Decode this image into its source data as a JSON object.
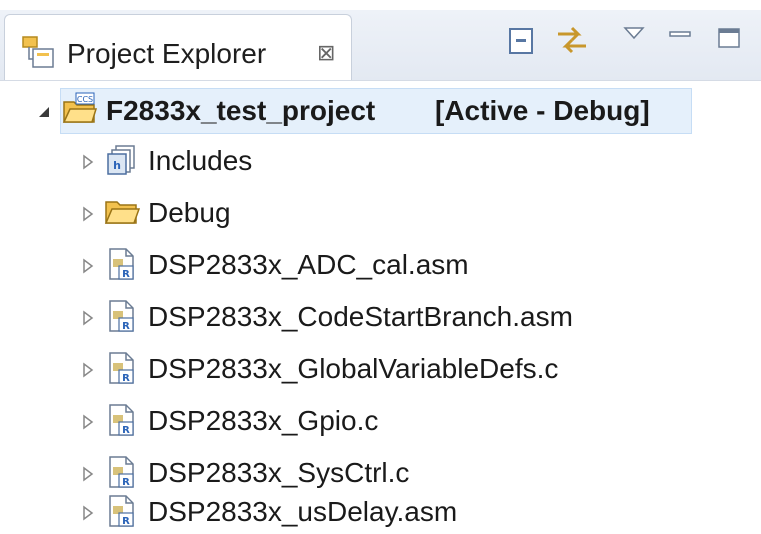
{
  "view": {
    "title": "Project Explorer",
    "close_glyph": "⊠",
    "toolbar": {
      "collapse_all_icon": "collapse-all-icon",
      "link_editor_icon": "link-with-editor-icon",
      "view_menu_icon": "view-menu-icon",
      "minimize_icon": "minimize-icon",
      "maximize_icon": "maximize-icon"
    }
  },
  "tree": {
    "project": {
      "name": "F2833x_test_project",
      "status": "[Active - Debug]",
      "badge": "CCS",
      "expanded": true
    },
    "items": [
      {
        "label": "Includes",
        "icon": "includes-icon"
      },
      {
        "label": "Debug",
        "icon": "folder-icon"
      },
      {
        "label": "DSP2833x_ADC_cal.asm",
        "icon": "source-file-icon"
      },
      {
        "label": "DSP2833x_CodeStartBranch.asm",
        "icon": "source-file-icon"
      },
      {
        "label": "DSP2833x_GlobalVariableDefs.c",
        "icon": "source-file-icon"
      },
      {
        "label": "DSP2833x_Gpio.c",
        "icon": "source-file-icon"
      },
      {
        "label": "DSP2833x_SysCtrl.c",
        "icon": "source-file-icon"
      },
      {
        "label": "DSP2833x_usDelay.asm",
        "icon": "source-file-icon"
      }
    ]
  },
  "colors": {
    "selection": "#e5f0fb",
    "folder": "#f2c14e",
    "accent": "#2a63b8"
  }
}
